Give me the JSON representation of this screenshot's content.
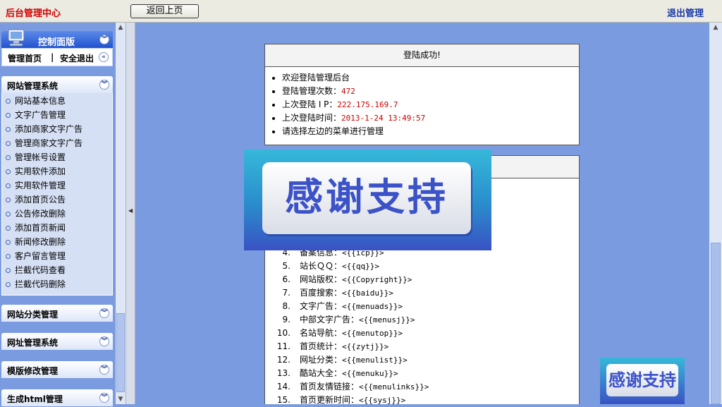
{
  "topbar": {
    "brand": "后台管理中心",
    "back_button": "返回上页",
    "logout": "退出管理"
  },
  "sidebar": {
    "control_panel": {
      "title": "控制面版",
      "home_link": "管理首页",
      "separator": "|",
      "logout_link": "安全退出"
    },
    "groups": [
      {
        "title": "网站管理系统",
        "items": [
          "网站基本信息",
          "文字广告管理",
          "添加商家文字广告",
          "管理商家文字广告",
          "管理帐号设置",
          "实用软件添加",
          "实用软件管理",
          "添加首页公告",
          "公告修改删除",
          "添加首页新闻",
          "新闻修改删除",
          "客户留言管理",
          "拦截代码查看",
          "拦截代码删除"
        ]
      },
      {
        "title": "网站分类管理"
      },
      {
        "title": "网址管理系统"
      },
      {
        "title": "模版修改管理"
      },
      {
        "title": "生成html管理"
      }
    ]
  },
  "login_card": {
    "header": "登陆成功!",
    "lines": [
      {
        "label": "欢迎登陆管理后台",
        "value": ""
      },
      {
        "label": "登陆管理次数：",
        "value": "472"
      },
      {
        "label": "上次登陆 I P：",
        "value": "222.175.169.7"
      },
      {
        "label": "上次登陆时间：",
        "value": "2013-1-24 13:49:57"
      },
      {
        "label": "请选择左边的菜单进行管理",
        "value": ""
      }
    ]
  },
  "tags_card": {
    "rows": [
      {
        "num": "4.",
        "label": "备案信息：",
        "code": "<{{icp}}>"
      },
      {
        "num": "5.",
        "label": "站长ＱＱ：",
        "code": "<{{qq}}>"
      },
      {
        "num": "6.",
        "label": "网站版权：",
        "code": "<{{Copyright}}>"
      },
      {
        "num": "7.",
        "label": "百度搜索：",
        "code": "<{{baidu}}>"
      },
      {
        "num": "8.",
        "label": "文字广告：",
        "code": "<{{menuads}}>"
      },
      {
        "num": "9.",
        "label": "中部文字广告：",
        "code": "<{{menusj}}>"
      },
      {
        "num": "10.",
        "label": "名站导航：",
        "code": "<{{menutop}}>"
      },
      {
        "num": "11.",
        "label": "首页统计：",
        "code": "<{{zytj}}>"
      },
      {
        "num": "12.",
        "label": "网址分类：",
        "code": "<{{menulist}}>"
      },
      {
        "num": "13.",
        "label": "酷站大全：",
        "code": "<{{menuku}}>"
      },
      {
        "num": "14.",
        "label": "首页友情链接：",
        "code": "<{{menulinks}}>"
      },
      {
        "num": "15.",
        "label": "首页更新时间：",
        "code": "<{{sysj}}>"
      }
    ]
  },
  "overlay": {
    "banner_text": "感谢支持",
    "mini_text": "感谢支持"
  },
  "colors": {
    "brand": "#d40000",
    "logout": "#1a3aa8",
    "page_bg": "#7b9be0",
    "value_red": "#cc0000",
    "banner_text": "#3b52c8"
  },
  "icons": {
    "collapse": "chevron-double-down-icon",
    "expand_left": "chevron-double-left-icon",
    "bullet": "circle-bullet-icon"
  }
}
